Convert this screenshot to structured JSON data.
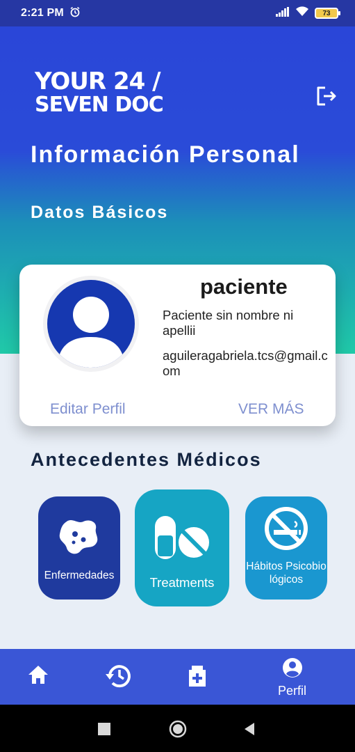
{
  "status_bar": {
    "time": "2:21 PM",
    "battery": "73",
    "icons": [
      "alarm-icon",
      "signal-icon",
      "wifi-icon",
      "battery-icon"
    ]
  },
  "header": {
    "logo_line1": "YOUR 24 /",
    "logo_line2": "SEVEN DOC",
    "logout_icon": "logout-icon"
  },
  "page": {
    "title": "Información Personal",
    "subtitle": "Datos Básicos"
  },
  "profile": {
    "role": "paciente",
    "name": "Paciente sin nombre ni apellii",
    "email": "aguileragabriela.tcs@gmail.com",
    "edit_label": "Editar Perfil",
    "more_label": "VER MÁS"
  },
  "medical_history": {
    "title": "Antecedentes Médicos",
    "buttons": [
      {
        "label": "Enfermedades",
        "icon": "virus-icon"
      },
      {
        "label": "Treatments",
        "icon": "pills-icon"
      },
      {
        "label": "Hábitos Psicobiológicos",
        "icon": "no-smoking-icon"
      }
    ]
  },
  "bottom_nav": {
    "items": [
      {
        "icon": "home-icon",
        "label": ""
      },
      {
        "icon": "history-icon",
        "label": ""
      },
      {
        "icon": "medical-add-icon",
        "label": ""
      },
      {
        "icon": "profile-icon",
        "label": "Perfil"
      }
    ]
  },
  "colors": {
    "status_bar": "#2637a3",
    "gradient_top": "#2a46d8",
    "gradient_bottom": "#20c9a8",
    "nav": "#3a56d6",
    "link": "#7e8fcf"
  }
}
